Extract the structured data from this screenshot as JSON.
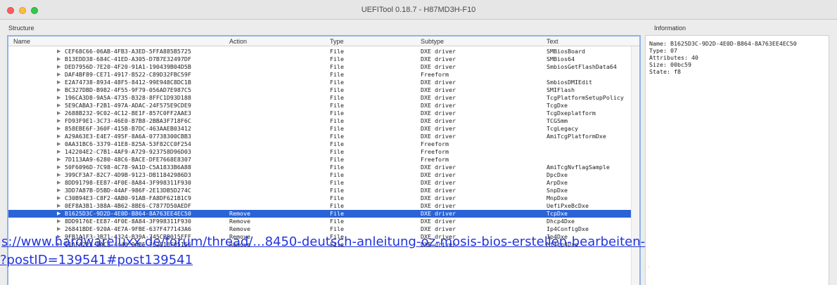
{
  "window": {
    "title": "UEFITool 0.18.7 - H87MD3H-F10"
  },
  "panels": {
    "structure_label": "Structure",
    "information_label": "Information"
  },
  "columns": [
    "Name",
    "Action",
    "Type",
    "Subtype",
    "Text"
  ],
  "rows": [
    {
      "name": "CEF68C66-06AB-4FB3-A3ED-5FFA885B5725",
      "action": "",
      "type": "File",
      "subtype": "DXE driver",
      "text": "SMBiosBoard"
    },
    {
      "name": "B13EDD38-684C-41ED-A305-D7B7E32497DF",
      "action": "",
      "type": "File",
      "subtype": "DXE driver",
      "text": "SMBios64"
    },
    {
      "name": "DED7956D-7E20-4F20-91A1-190439B04D5B",
      "action": "",
      "type": "File",
      "subtype": "DXE driver",
      "text": "SmbiosGetFlashData64"
    },
    {
      "name": "DAF4BF89-CE71-4917-B522-C89D32FBC59F",
      "action": "",
      "type": "File",
      "subtype": "Freeform",
      "text": ""
    },
    {
      "name": "E2A74738-8934-48F5-8412-99E948C8DC1B",
      "action": "",
      "type": "File",
      "subtype": "DXE driver",
      "text": "SmbiosDMIEdit"
    },
    {
      "name": "BC327DBD-B982-4F55-9F79-056AD7E987C5",
      "action": "",
      "type": "File",
      "subtype": "DXE driver",
      "text": "SMIFlash"
    },
    {
      "name": "196CA3D8-9A5A-4735-B328-8FFC1D93D188",
      "action": "",
      "type": "File",
      "subtype": "DXE driver",
      "text": "TcgPlatformSetupPolicy"
    },
    {
      "name": "5E9CABA3-F2B1-497A-ADAC-24F575E9CDE9",
      "action": "",
      "type": "File",
      "subtype": "DXE driver",
      "text": "TcgDxe"
    },
    {
      "name": "2688B232-9C02-4C12-BE1F-857C0FF2AAE3",
      "action": "",
      "type": "File",
      "subtype": "DXE driver",
      "text": "TcgDxeplatform"
    },
    {
      "name": "FD93F9E1-3C73-46E0-B7B8-2BBA3F718F6C",
      "action": "",
      "type": "File",
      "subtype": "DXE driver",
      "text": "TCGSmm"
    },
    {
      "name": "858EBE6F-360F-415B-B7DC-463AAEB03412",
      "action": "",
      "type": "File",
      "subtype": "DXE driver",
      "text": "TcgLegacy"
    },
    {
      "name": "A29A63E3-E4E7-495F-8A6A-07738300CBB3",
      "action": "",
      "type": "File",
      "subtype": "DXE driver",
      "text": "AmiTcgPlatformDxe"
    },
    {
      "name": "0AA31BC6-3379-41E8-825A-53F82CC0F254",
      "action": "",
      "type": "File",
      "subtype": "Freeform",
      "text": ""
    },
    {
      "name": "142204E2-C7B1-4AF9-A729-923758D96D03",
      "action": "",
      "type": "File",
      "subtype": "Freeform",
      "text": ""
    },
    {
      "name": "7D113AA9-6280-48C6-BACE-DFE7668E8307",
      "action": "",
      "type": "File",
      "subtype": "Freeform",
      "text": ""
    },
    {
      "name": "50F6096D-7C98-4C78-9A1D-C5A1833B6A88",
      "action": "",
      "type": "File",
      "subtype": "DXE driver",
      "text": "AmiTcgNvflagSample"
    },
    {
      "name": "399CF3A7-82C7-4D9B-9123-DB11842986D3",
      "action": "",
      "type": "File",
      "subtype": "DXE driver",
      "text": "DpcDxe"
    },
    {
      "name": "8DD91798-EE87-4F0E-8A84-3F998311F930",
      "action": "",
      "type": "File",
      "subtype": "DXE driver",
      "text": "ArpDxe"
    },
    {
      "name": "3DD7A87B-D5BD-44AF-986F-2E13DB5D274C",
      "action": "",
      "type": "File",
      "subtype": "DXE driver",
      "text": "SnpDxe"
    },
    {
      "name": "C30B94E3-C8F2-4AB0-91AB-FA8DF621B1C9",
      "action": "",
      "type": "File",
      "subtype": "DXE driver",
      "text": "MnpDxe"
    },
    {
      "name": "0EF8A3B1-388A-4B62-8BE6-C7877D50AEDF",
      "action": "",
      "type": "File",
      "subtype": "DXE driver",
      "text": "UefiPxeBcDxe"
    },
    {
      "name": "B1625D3C-9D2D-4E0D-B864-8A763EE4EC50",
      "action": "Remove",
      "type": "File",
      "subtype": "DXE driver",
      "text": "TcpDxe",
      "selected": true
    },
    {
      "name": "8DD9176E-EE87-4F0E-8A84-3F998311F930",
      "action": "Remove",
      "type": "File",
      "subtype": "DXE driver",
      "text": "Dhcp4Dxe"
    },
    {
      "name": "26841BDE-920A-4E7A-9FBE-637F477143A6",
      "action": "Remove",
      "type": "File",
      "subtype": "DXE driver",
      "text": "Ip4ConfigDxe"
    },
    {
      "name": "9FB1A1F3-3B71-4324-B39A-745CBB015FFF",
      "action": "Remove",
      "type": "File",
      "subtype": "DXE driver",
      "text": "Ip4Dxe"
    },
    {
      "name": "61AFA223-8AC8-4440-9AB5-762B1BF05156",
      "action": "Remove",
      "type": "File",
      "subtype": "DXE driver",
      "text": "Mtftp4Dxe"
    }
  ],
  "info": {
    "lines": [
      "Name: B1625D3C-9D2D-4E0D-B864-8A763EE4EC50",
      "Type: 07",
      "Attributes: 40",
      "Size: 00bc59",
      "State: f8"
    ]
  },
  "overlay_link": {
    "line1": "s://www.hardwareluxx.de/forum/thread/...8450-deutsch-anleitung-oz-mosis-bios-erstellen-bearbeiten-",
    "line2": "?postID=139541#post139541"
  }
}
